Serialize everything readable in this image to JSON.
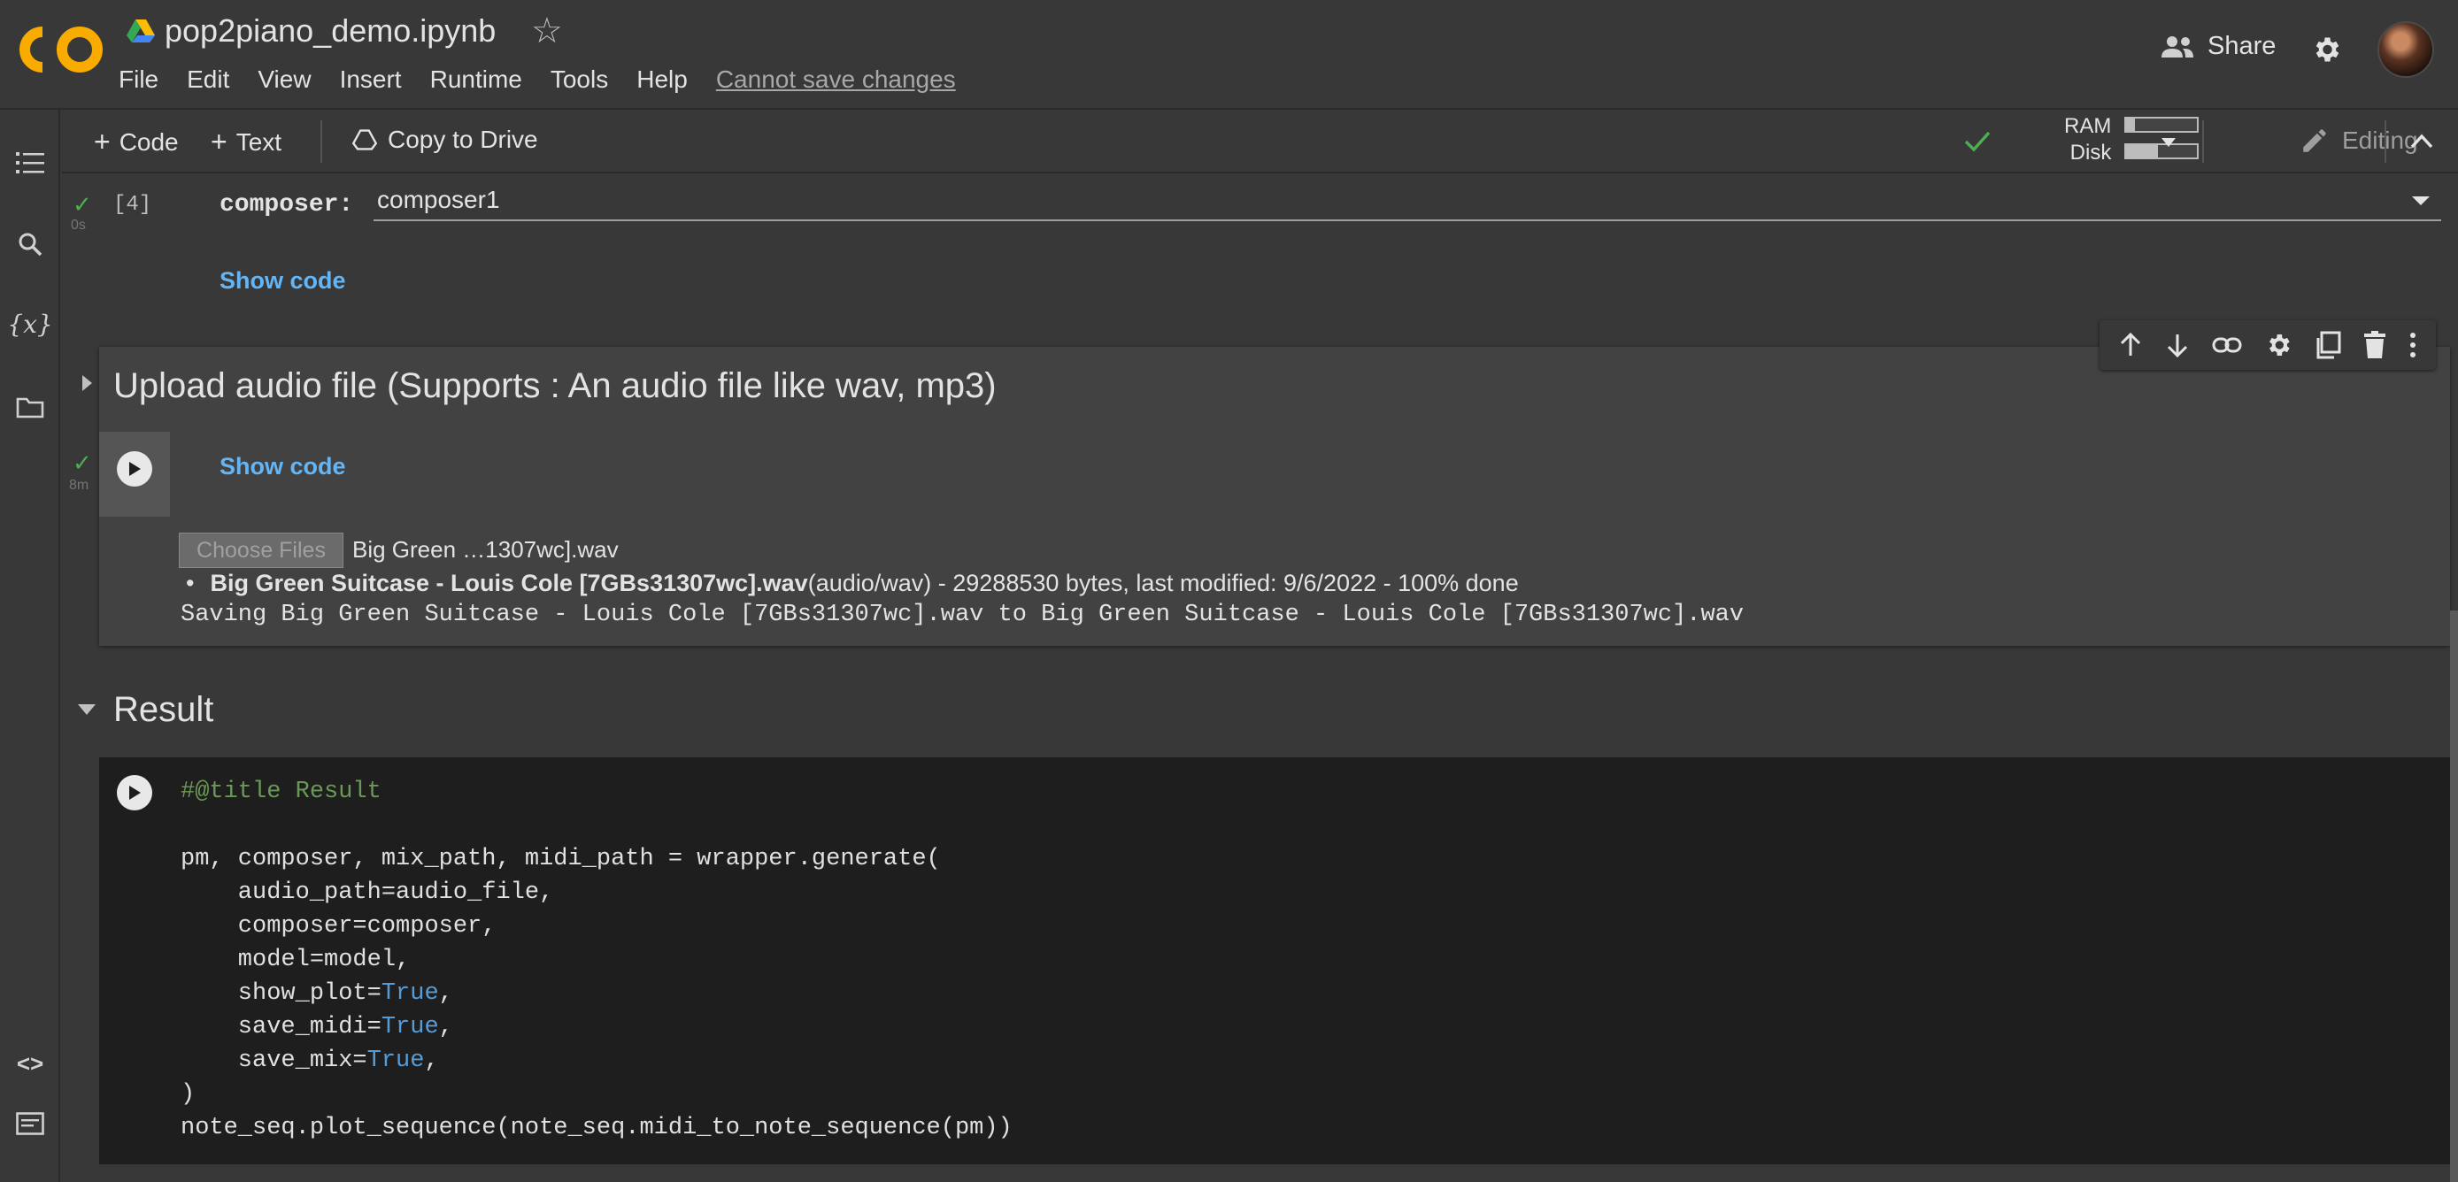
{
  "header": {
    "notebook_title": "pop2piano_demo.ipynb",
    "menu": [
      "File",
      "Edit",
      "View",
      "Insert",
      "Runtime",
      "Tools",
      "Help"
    ],
    "cannot_save": "Cannot save changes",
    "share_label": "Share"
  },
  "toolbar": {
    "code_label": "Code",
    "text_label": "Text",
    "copy_label": "Copy to Drive",
    "ram_label": "RAM",
    "disk_label": "Disk",
    "ram_level": 0.12,
    "disk_level": 0.45,
    "editing_label": "Editing"
  },
  "cell_composer": {
    "exec_count": "[4]",
    "time": "0s",
    "label": "composer:",
    "value": "composer1",
    "show_code": "Show code"
  },
  "upload_cell": {
    "title": "Upload audio file (Supports : An audio file like wav, mp3)",
    "time": "8m",
    "show_code": "Show code",
    "choose_files": "Choose Files",
    "chosen_name": "Big Green …1307wc].wav",
    "file_bold": "Big Green Suitcase - Louis Cole [7GBs31307wc].wav",
    "file_meta": "(audio/wav) - 29288530 bytes, last modified: 9/6/2022 - 100% done",
    "saving": "Saving Big Green Suitcase - Louis Cole [7GBs31307wc].wav to Big Green Suitcase - Louis Cole [7GBs31307wc].wav"
  },
  "result_section": {
    "title": "Result",
    "code_comment": "#@title Result",
    "line1": "pm, composer, mix_path, midi_path = wrapper.generate(",
    "line2": "    audio_path=audio_file,",
    "line3": "    composer=composer,",
    "line4": "    model=model,",
    "line5_pre": "    show_plot=",
    "line6_pre": "    save_midi=",
    "line7_pre": "    save_mix=",
    "true_kw": "True",
    "comma": ",",
    "line8": ")",
    "line9": "note_seq.plot_sequence(note_seq.midi_to_note_sequence(pm))"
  },
  "colors": {
    "background": "#383838",
    "code_bg": "#1e1e1e",
    "link": "#64b5f6",
    "check": "#4caf50",
    "keyword": "#569cd6",
    "comment": "#6a9955",
    "logo_orange": "#f9ab00"
  },
  "icons": [
    "colab-logo",
    "drive-icon",
    "star-icon",
    "people-icon",
    "gear-icon",
    "toc-icon",
    "search-icon",
    "variables-icon",
    "folder-icon",
    "code-snippets-icon",
    "terminal-icon"
  ]
}
